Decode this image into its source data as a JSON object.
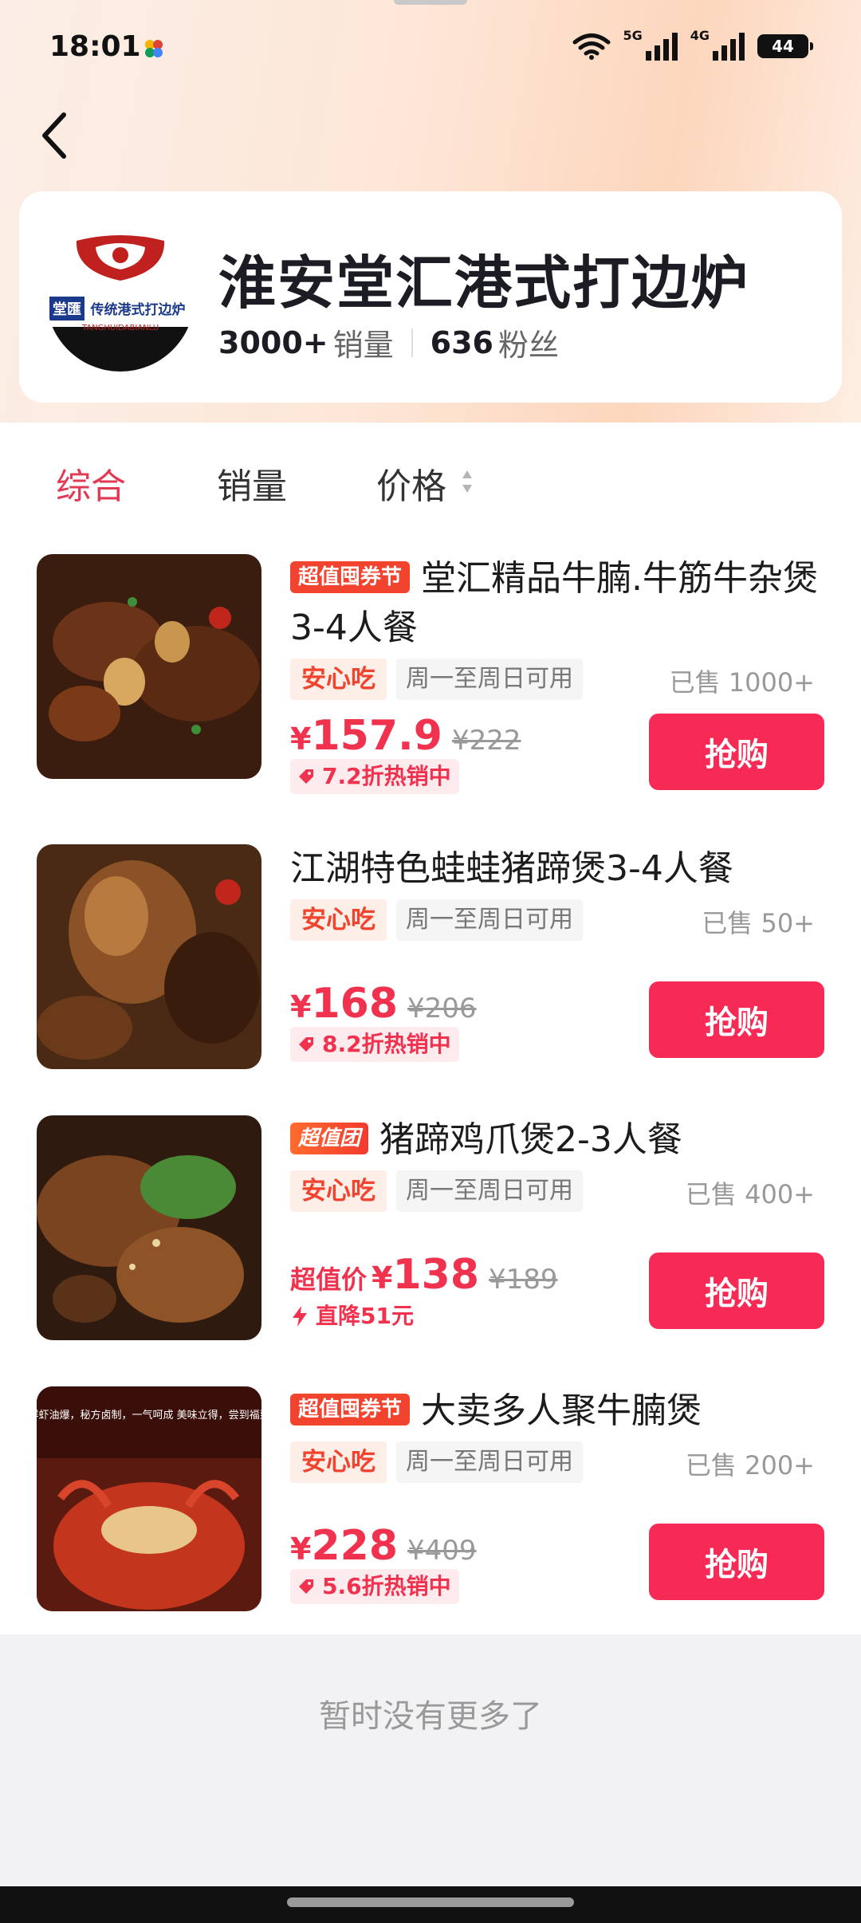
{
  "status_bar": {
    "time": "18:01",
    "network_1": "5G",
    "network_2": "4G",
    "battery": "44"
  },
  "store": {
    "name": "淮安堂汇港式打边炉",
    "sales": "3000+",
    "sales_label": "销量",
    "fans": "636",
    "fans_label": "粉丝",
    "logo_text": "传统港式打边炉",
    "logo_sub": "TANGHUIDABIANLU",
    "logo_char": "堂匯"
  },
  "sort_tabs": [
    {
      "label": "综合",
      "active": true
    },
    {
      "label": "销量",
      "active": false
    },
    {
      "label": "价格",
      "active": false
    }
  ],
  "products": [
    {
      "badge": "超值囤券节",
      "title": "堂汇精品牛腩.牛筋牛杂煲3-4人餐",
      "tag_safe": "安心吃",
      "tag_days": "周一至周日可用",
      "sold": "已售 1000+",
      "price_prefix": "",
      "yen": "¥",
      "price": "157.9",
      "orig": "¥222",
      "promo": "7.2折热销中",
      "buy": "抢购"
    },
    {
      "badge": "",
      "title": "江湖特色蛙蛙猪蹄煲3-4人餐",
      "tag_safe": "安心吃",
      "tag_days": "周一至周日可用",
      "sold": "已售 50+",
      "price_prefix": "",
      "yen": "¥",
      "price": "168",
      "orig": "¥206",
      "promo": "8.2折热销中",
      "buy": "抢购"
    },
    {
      "badge": "超值团",
      "title": "猪蹄鸡爪煲2-3人餐",
      "tag_safe": "安心吃",
      "tag_days": "周一至周日可用",
      "sold": "已售 400+",
      "price_prefix": "超值价",
      "yen": "¥",
      "price": "138",
      "orig": "¥189",
      "promo": "直降51元",
      "buy": "抢购"
    },
    {
      "badge": "超值囤券节",
      "title": "大卖多人聚牛腩煲",
      "tag_safe": "安心吃",
      "tag_days": "周一至周日可用",
      "sold": "已售 200+",
      "price_prefix": "",
      "yen": "¥",
      "price": "228",
      "orig": "¥409",
      "promo": "5.6折热销中",
      "buy": "抢购"
    }
  ],
  "thumb4_text": "鲜虾油爆，秘方卤制，一气呵成 美味立得，尝到福到",
  "footer": "暂时没有更多了",
  "colors": {
    "accent": "#f62a54",
    "active_tab": "#e13a55",
    "badge": "#f1432d"
  }
}
